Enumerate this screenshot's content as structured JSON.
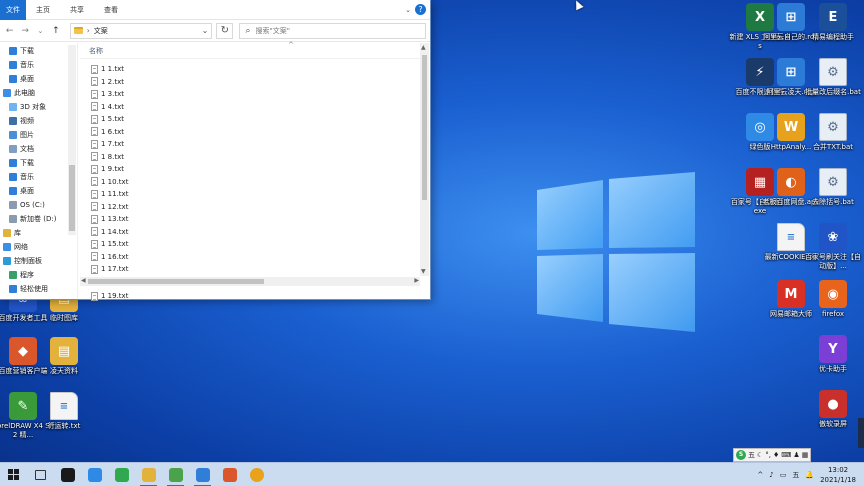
{
  "explorer": {
    "ribbon": {
      "file_tab": "文件",
      "tabs": [
        "主页",
        "共享",
        "查看"
      ],
      "collapse_glyph": "⌄",
      "help_glyph": "?"
    },
    "address": {
      "crumb": "文案",
      "separator": "›"
    },
    "search": {
      "placeholder": "搜索\"文案\""
    },
    "nav_items": [
      {
        "label": "下载",
        "icon": "download-icon",
        "color": "#2f7fd8",
        "indent": 1
      },
      {
        "label": "音乐",
        "icon": "music-icon",
        "color": "#2f7fd8",
        "indent": 1
      },
      {
        "label": "桌面",
        "icon": "desktop-icon",
        "color": "#2f7fd8",
        "indent": 1
      },
      {
        "label": "此电脑",
        "icon": "pc-icon",
        "color": "#3d8ee6",
        "indent": 0
      },
      {
        "label": "3D 对象",
        "icon": "3d-objects-icon",
        "color": "#6fb3ef",
        "indent": 1
      },
      {
        "label": "视频",
        "icon": "video-icon",
        "color": "#3d6fa8",
        "indent": 1
      },
      {
        "label": "图片",
        "icon": "pictures-icon",
        "color": "#4b8fd6",
        "indent": 1
      },
      {
        "label": "文档",
        "icon": "documents-icon",
        "color": "#7f9ec2",
        "indent": 1
      },
      {
        "label": "下载",
        "icon": "download-icon",
        "color": "#2f7fd8",
        "indent": 1
      },
      {
        "label": "音乐",
        "icon": "music-icon",
        "color": "#2f7fd8",
        "indent": 1
      },
      {
        "label": "桌面",
        "icon": "desktop-icon",
        "color": "#2f7fd8",
        "indent": 1
      },
      {
        "label": "OS (C:)",
        "icon": "drive-icon",
        "color": "#8a9bb0",
        "indent": 1
      },
      {
        "label": "新加卷 (D:)",
        "icon": "drive-icon",
        "color": "#8a9bb0",
        "indent": 1
      },
      {
        "label": "库",
        "icon": "library-icon",
        "color": "#e3b23c",
        "indent": 0
      },
      {
        "label": "网络",
        "icon": "network-icon",
        "color": "#3d8ee6",
        "indent": 0
      },
      {
        "label": "控制面板",
        "icon": "control-panel-icon",
        "color": "#2f9ad8",
        "indent": 0
      },
      {
        "label": "程序",
        "icon": "programs-icon",
        "color": "#3aa06a",
        "indent": 1
      },
      {
        "label": "轻松使用",
        "icon": "ease-of-access-icon",
        "color": "#2f7fd8",
        "indent": 1
      }
    ],
    "column_name": "名称",
    "sort_caret": "^",
    "files": [
      "1 1.txt",
      "1 2.txt",
      "1 3.txt",
      "1 4.txt",
      "1 5.txt",
      "1 6.txt",
      "1 7.txt",
      "1 8.txt",
      "1 9.txt",
      "1 10.txt",
      "1 11.txt",
      "1 12.txt",
      "1 13.txt",
      "1 14.txt",
      "1 15.txt",
      "1 16.txt",
      "1 17.txt"
    ],
    "last_file": "1 19.txt"
  },
  "desktop_icons": [
    {
      "label": "新建 XLS 工作表.xls",
      "bg": "#1e7a42",
      "glyph": "X"
    },
    {
      "label": "阿里云自己的.rdp",
      "bg": "#2c7bd6",
      "glyph": "⊞"
    },
    {
      "label": "精易编程助手",
      "bg": "#1b4f9a",
      "glyph": "E"
    },
    {
      "label": "百度不限速软件",
      "bg": "#1a3a6a",
      "glyph": "⚡"
    },
    {
      "label": "阿里云凌天.rdp",
      "bg": "#2c7bd6",
      "glyph": "⊞"
    },
    {
      "label": "批量改后缀名.bat",
      "bg": "#e8eef6",
      "glyph": "⚙"
    },
    {
      "label": "绿色版",
      "bg": "#2f8ae6",
      "glyph": "◎"
    },
    {
      "label": "HttpAnaly...",
      "bg": "#e6a21c",
      "glyph": "W"
    },
    {
      "label": "合并TXT.bat",
      "bg": "#e8eef6",
      "glyph": "⚙"
    },
    {
      "label": "百家号【自动版】.exe",
      "bg": "#b52020",
      "glyph": "▦"
    },
    {
      "label": "老板百度网盘.apk",
      "bg": "#e0621a",
      "glyph": "◐"
    },
    {
      "label": "去除括号.bat",
      "bg": "#e8eef6",
      "glyph": "⚙"
    },
    {
      "label": "最新COOKIE.txt",
      "bg": "#f4f4f4",
      "glyph": ""
    },
    {
      "label": "百家号刷关注【自动版】...",
      "bg": "#2155c7",
      "glyph": "❀"
    },
    {
      "label": "网易邮箱大师",
      "bg": "#d93025",
      "glyph": "M"
    },
    {
      "label": "firefox",
      "bg": "#e8641c",
      "glyph": "◉"
    },
    {
      "label": "优卡助手",
      "bg": "#7b3fd6",
      "glyph": "Y"
    },
    {
      "label": "傲软录屏",
      "bg": "#c9302c",
      "glyph": "●"
    },
    {
      "label": "百度开发者工具",
      "bg": "#2155c7",
      "glyph": "❀"
    },
    {
      "label": "临时图库",
      "bg": "#e3b23c",
      "glyph": "▤"
    },
    {
      "label": "百度营销客户端",
      "bg": "#d9572a",
      "glyph": "◆"
    },
    {
      "label": "凌天资料",
      "bg": "#e3b23c",
      "glyph": "▤"
    },
    {
      "label": "CorelDRAW X4 SP2 精...",
      "bg": "#3a9a3a",
      "glyph": "✎"
    },
    {
      "label": "行运转.txt",
      "bg": "#f4f4f4",
      "glyph": ""
    }
  ],
  "taskbar": {
    "apps": [
      {
        "name": "start-button-icon",
        "color": "#1b1b1b"
      },
      {
        "name": "task-view-icon",
        "color": "#333333"
      },
      {
        "name": "qq-icon",
        "color": "#1a1a1a"
      },
      {
        "name": "pdf-app-icon",
        "color": "#2f8ae6"
      },
      {
        "name": "wechat-icon",
        "color": "#2fa84f"
      },
      {
        "name": "file-explorer-icon",
        "color": "#e3b23c"
      },
      {
        "name": "image-app-icon",
        "color": "#4aa34a"
      },
      {
        "name": "store-icon",
        "color": "#2f7fd8"
      },
      {
        "name": "dialog-app-icon",
        "color": "#d9572a"
      },
      {
        "name": "chrome-icon",
        "color": "#e8a21c"
      }
    ],
    "tray_icons": [
      "^",
      "♪",
      "▭",
      "🔔"
    ],
    "ime_label": "五",
    "time": "13:02",
    "date": "2021/1/18"
  }
}
